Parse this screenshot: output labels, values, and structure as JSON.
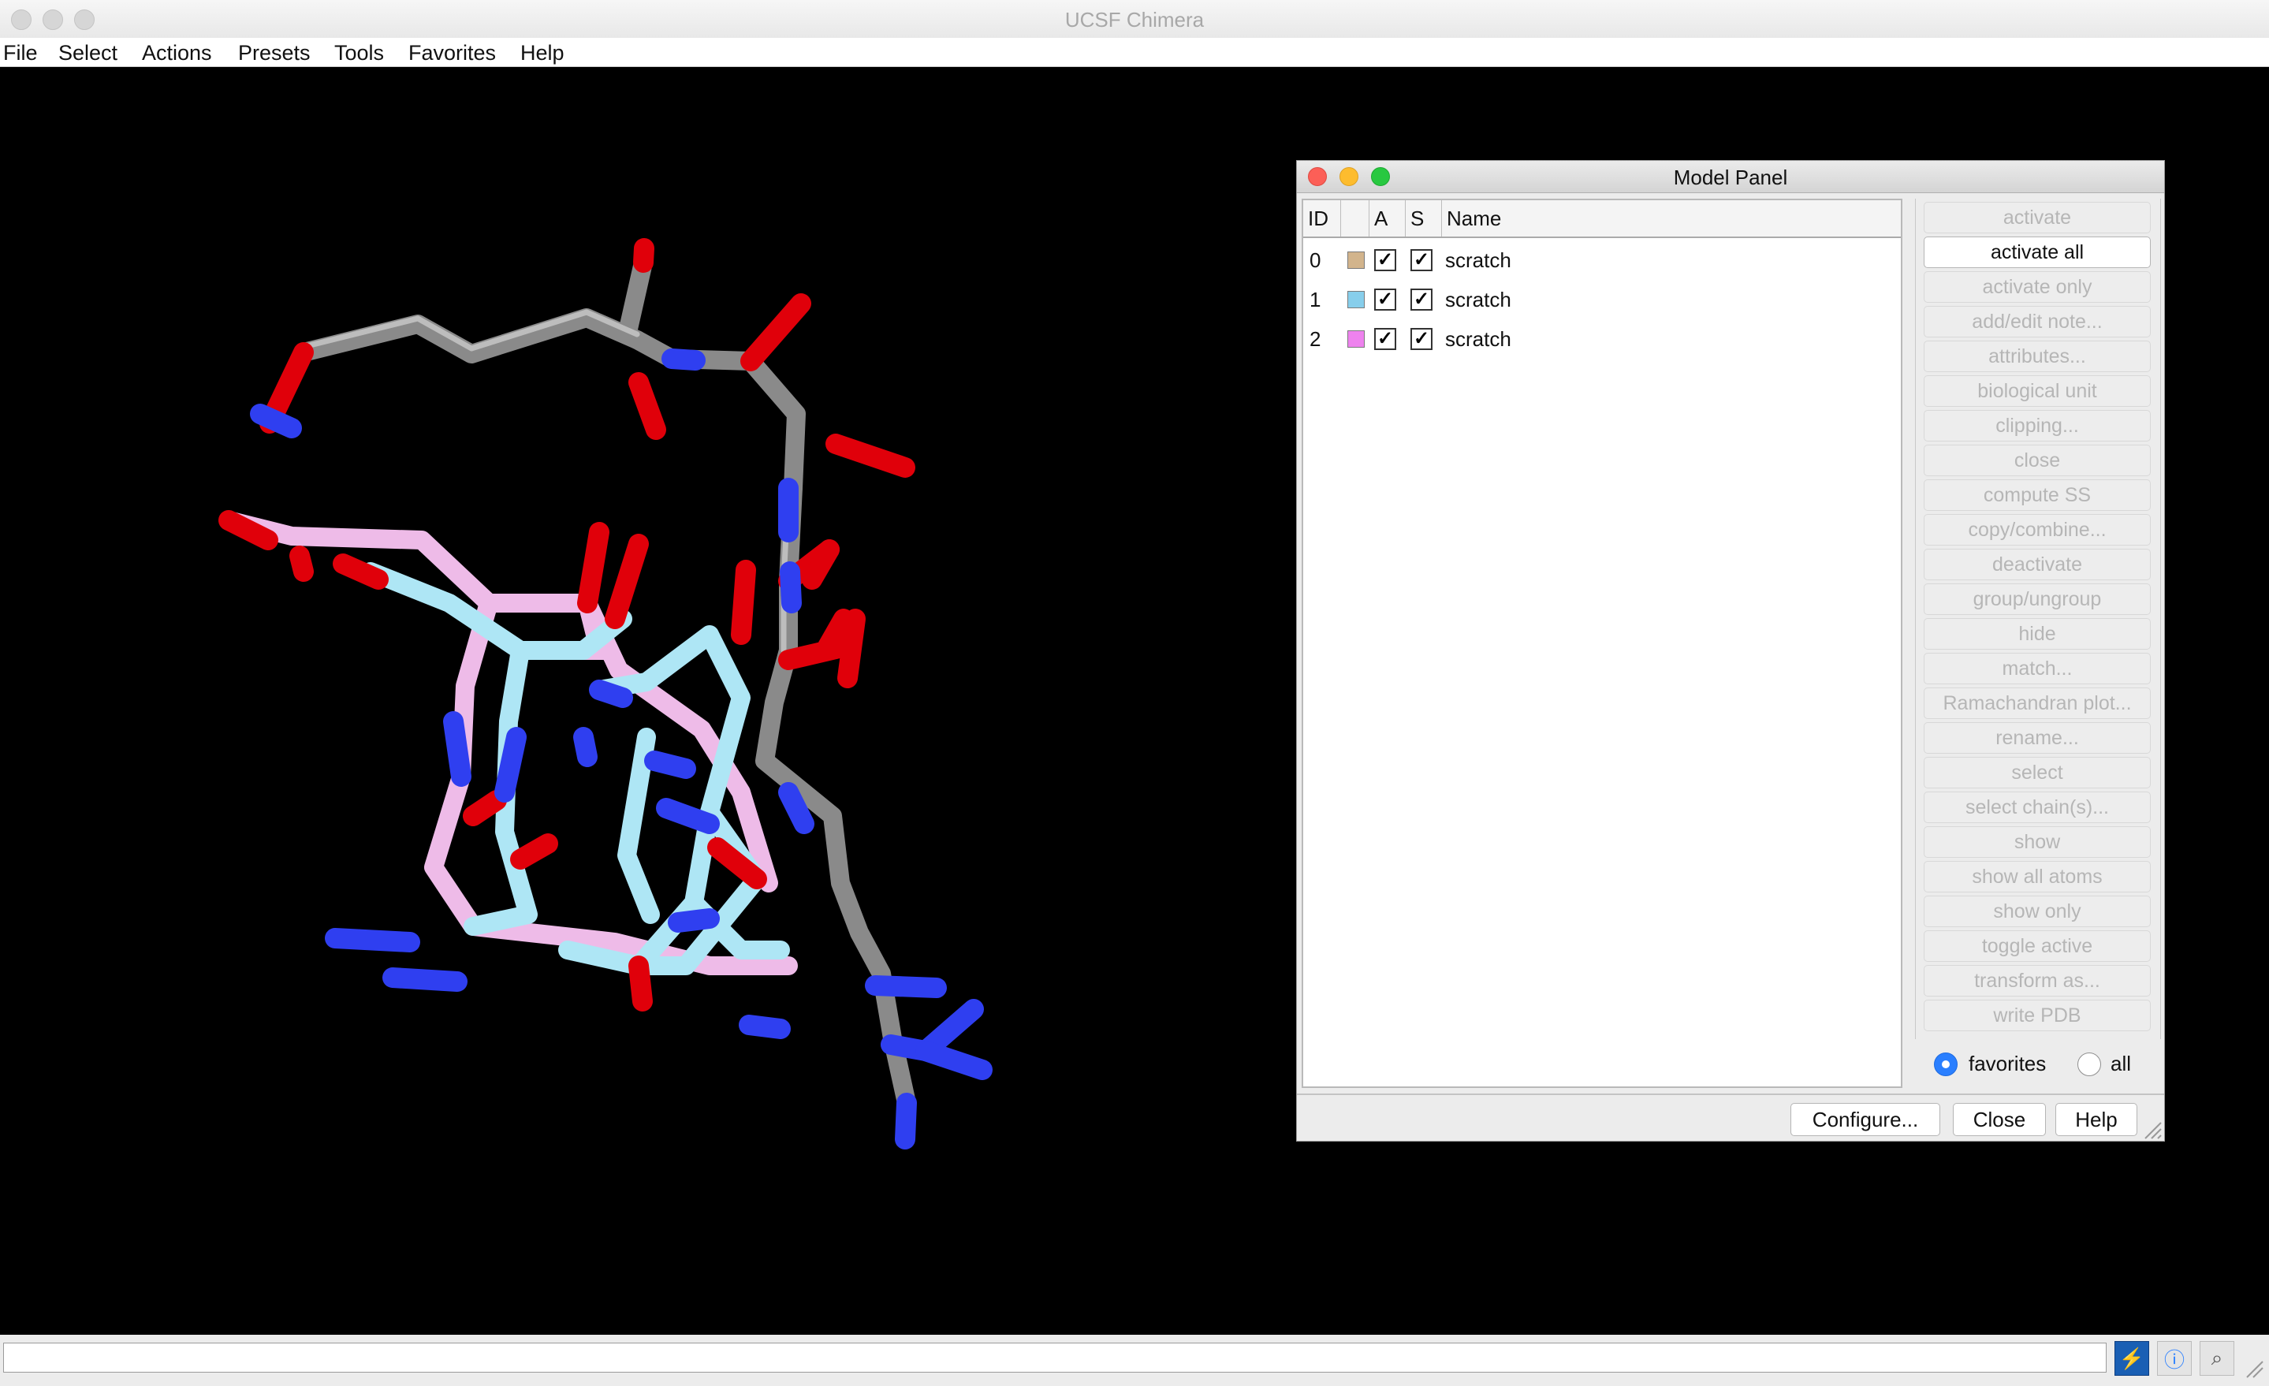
{
  "window": {
    "title": "UCSF Chimera"
  },
  "menubar": {
    "items": [
      "File",
      "Select",
      "Actions",
      "Presets",
      "Tools",
      "Favorites",
      "Help"
    ]
  },
  "model_panel": {
    "title": "Model Panel",
    "columns": {
      "id": "ID",
      "active": "A",
      "shown": "S",
      "name": "Name"
    },
    "models": [
      {
        "id": "0",
        "color": "#d2b48c",
        "active": "✓",
        "shown": "✓",
        "name": "scratch"
      },
      {
        "id": "1",
        "color": "#87ceeb",
        "active": "✓",
        "shown": "✓",
        "name": "scratch"
      },
      {
        "id": "2",
        "color": "#ee82ee",
        "active": "✓",
        "shown": "✓",
        "name": "scratch"
      }
    ],
    "commands": [
      {
        "label": "activate",
        "enabled": false
      },
      {
        "label": "activate all",
        "enabled": true
      },
      {
        "label": "activate only",
        "enabled": false
      },
      {
        "label": "add/edit note...",
        "enabled": false
      },
      {
        "label": "attributes...",
        "enabled": false
      },
      {
        "label": "biological unit",
        "enabled": false
      },
      {
        "label": "clipping...",
        "enabled": false
      },
      {
        "label": "close",
        "enabled": false
      },
      {
        "label": "compute SS",
        "enabled": false
      },
      {
        "label": "copy/combine...",
        "enabled": false
      },
      {
        "label": "deactivate",
        "enabled": false
      },
      {
        "label": "group/ungroup",
        "enabled": false
      },
      {
        "label": "hide",
        "enabled": false
      },
      {
        "label": "match...",
        "enabled": false
      },
      {
        "label": "Ramachandran plot...",
        "enabled": false
      },
      {
        "label": "rename...",
        "enabled": false
      },
      {
        "label": "select",
        "enabled": false
      },
      {
        "label": "select chain(s)...",
        "enabled": false
      },
      {
        "label": "show",
        "enabled": false
      },
      {
        "label": "show all atoms",
        "enabled": false
      },
      {
        "label": "show only",
        "enabled": false
      },
      {
        "label": "toggle active",
        "enabled": false
      },
      {
        "label": "transform as...",
        "enabled": false
      },
      {
        "label": "write PDB",
        "enabled": false
      }
    ],
    "filter": {
      "favorites_label": "favorites",
      "all_label": "all",
      "selected": "favorites"
    },
    "footer": {
      "configure": "Configure...",
      "close": "Close",
      "help": "Help"
    }
  },
  "status_bar": {
    "command_value": ""
  },
  "colors": {
    "carbon_grey": "#8c8c8c",
    "carbon_cyan": "#aee6f5",
    "carbon_pink": "#eebbe8",
    "nitrogen": "#2f3ff0",
    "oxygen": "#e0000a",
    "accent_blue": "#2a7fff"
  }
}
